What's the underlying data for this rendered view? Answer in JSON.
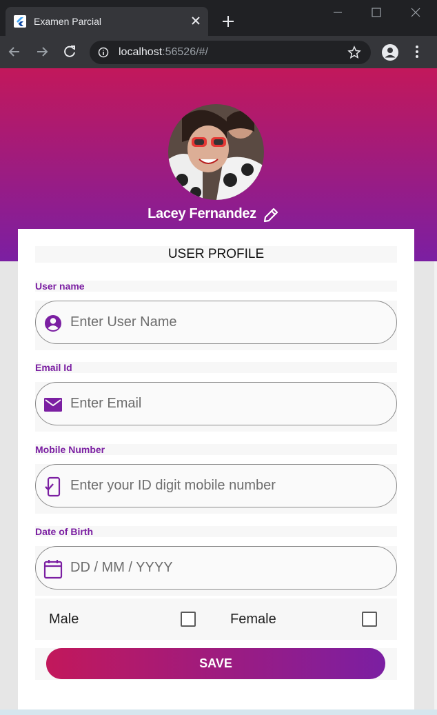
{
  "browser": {
    "tab_title": "Examen Parcial",
    "url_host": "localhost",
    "url_rest": ":56526/#/"
  },
  "profile": {
    "name": "Lacey Fernandez"
  },
  "form": {
    "title": "USER PROFILE",
    "fields": [
      {
        "label": "User name",
        "placeholder": "Enter User Name",
        "icon": "account-circle-icon"
      },
      {
        "label": "Email Id",
        "placeholder": "Enter Email",
        "icon": "email-icon"
      },
      {
        "label": "Mobile Number",
        "placeholder": "Enter your ID digit mobile number",
        "icon": "mobile-check-icon"
      },
      {
        "label": "Date of Birth",
        "placeholder": "DD / MM / YYYY",
        "icon": "calendar-icon"
      }
    ],
    "gender": {
      "male_label": "Male",
      "female_label": "Female",
      "male_checked": false,
      "female_checked": false
    },
    "save_label": "SAVE"
  },
  "colors": {
    "primary": "#7b1fa2",
    "accent": "#c2185b"
  }
}
